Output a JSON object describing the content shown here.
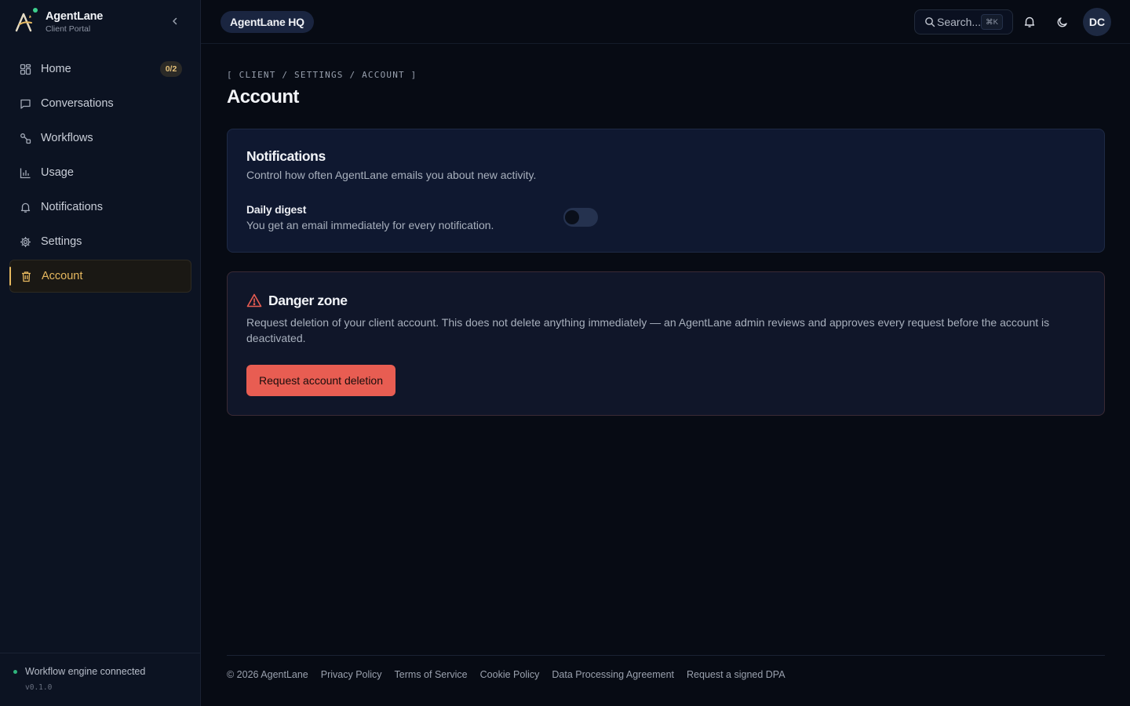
{
  "brand": {
    "name": "AgentLane",
    "subtitle": "Client Portal",
    "logo_icon": "agentlane-logo",
    "status_dot_color": "#3ecf8e"
  },
  "sidebar": {
    "collapse_icon": "chevron-left-icon",
    "items": [
      {
        "label": "Home",
        "icon": "grid-icon",
        "badge": "0/2",
        "active": false
      },
      {
        "label": "Conversations",
        "icon": "chat-icon",
        "active": false
      },
      {
        "label": "Workflows",
        "icon": "workflow-icon",
        "active": false
      },
      {
        "label": "Usage",
        "icon": "bar-chart-icon",
        "active": false
      },
      {
        "label": "Notifications",
        "icon": "bell-icon",
        "active": false
      },
      {
        "label": "Settings",
        "icon": "gear-icon",
        "active": false
      },
      {
        "label": "Account",
        "icon": "trash-icon",
        "active": true
      }
    ],
    "footer": {
      "status": "Workflow engine connected",
      "version": "v0.1.0"
    }
  },
  "header": {
    "workspace": "AgentLane HQ",
    "search": {
      "placeholder": "Search...",
      "shortcut": "⌘K"
    },
    "avatar_initials": "DC"
  },
  "page": {
    "breadcrumb": "[ CLIENT / SETTINGS / ACCOUNT ]",
    "title": "Account"
  },
  "notifications_card": {
    "title": "Notifications",
    "description": "Control how often AgentLane emails you about new activity.",
    "setting_label": "Daily digest",
    "setting_description": "You get an email immediately for every notification.",
    "daily_digest_enabled": false
  },
  "danger_card": {
    "title": "Danger zone",
    "description": "Request deletion of your client account. This does not delete anything immediately — an AgentLane admin reviews and approves every request before the account is deactivated.",
    "button_label": "Request account deletion",
    "accent_color": "#e85d52"
  },
  "footer": {
    "copyright": "© 2026 AgentLane",
    "links": [
      "Privacy Policy",
      "Terms of Service",
      "Cookie Policy",
      "Data Processing Agreement",
      "Request a signed DPA"
    ]
  },
  "colors": {
    "background": "#070b14",
    "sidebar": "#0c1322",
    "active_accent": "#e7b95f",
    "card": "#0f1830"
  }
}
